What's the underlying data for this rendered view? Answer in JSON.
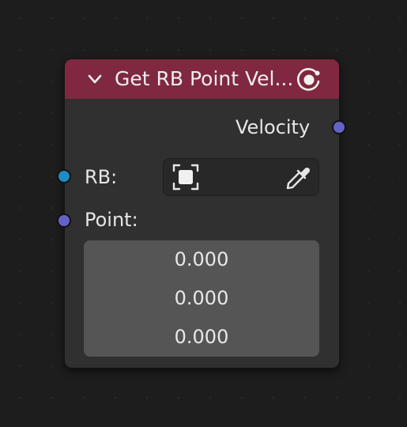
{
  "node": {
    "title": "Get RB Point Vel...",
    "header_color": "#80283f",
    "collapse_icon": "chevron-down-icon",
    "type_icon": "physics-rigid-body-icon"
  },
  "outputs": [
    {
      "label": "Velocity",
      "socket_color": "#6363c7"
    }
  ],
  "inputs": {
    "rb": {
      "label": "RB:",
      "socket_color": "#1f8bc4",
      "object_icon": "object-data-icon",
      "eyedropper_icon": "eyedropper-icon",
      "value": ""
    },
    "point": {
      "label": "Point:",
      "socket_color": "#6363c7",
      "values": [
        "0.000",
        "0.000",
        "0.000"
      ]
    }
  }
}
